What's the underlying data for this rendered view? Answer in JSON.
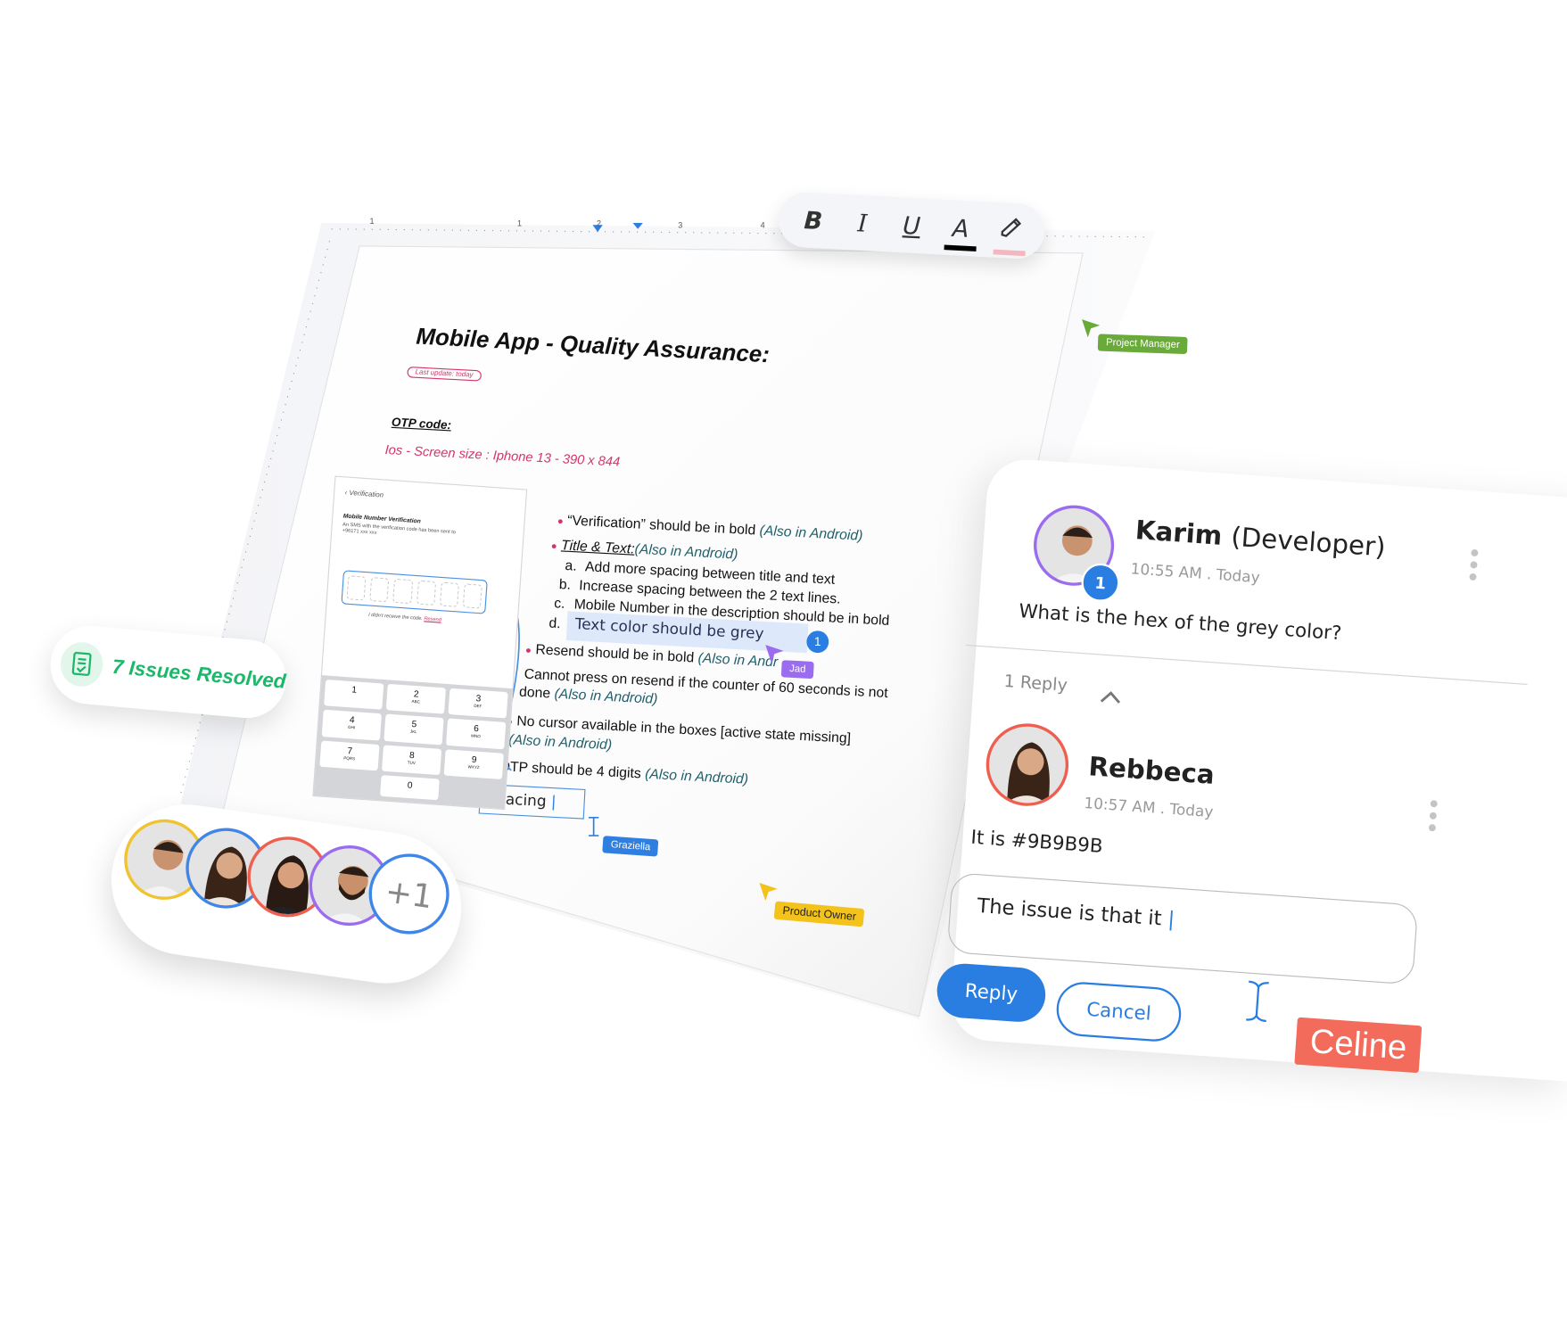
{
  "toolbar": {
    "bold": "B",
    "italic": "I",
    "underline": "U",
    "text_color": "A",
    "icons": [
      "bold-icon",
      "italic-icon",
      "underline-icon",
      "text-color-icon",
      "highlighter-icon"
    ],
    "text_color_value": "#000000",
    "highlight_color_value": "#f4b6bf"
  },
  "ruler": {
    "labels": [
      "1",
      "1",
      "2",
      "3",
      "4"
    ]
  },
  "document": {
    "title": "Mobile App - Quality Assurance:",
    "last_update": "Last update: today",
    "section": "OTP code:",
    "screen_size": "Ios - Screen size : Iphone 13 - 390 x 844",
    "phone": {
      "header": "Verification",
      "heading": "Mobile Number Verification",
      "body": "An SMS with the verification code has been sent to +96171 xxx xxx",
      "resend": "I didn't receive the code.",
      "resend_link": "Resend",
      "keys": [
        [
          "1",
          ""
        ],
        [
          "2",
          "ABC"
        ],
        [
          "3",
          "DEF"
        ],
        [
          "4",
          "GHI"
        ],
        [
          "5",
          "JKL"
        ],
        [
          "6",
          "MNO"
        ],
        [
          "7",
          "PQRS"
        ],
        [
          "8",
          "TUV"
        ],
        [
          "9",
          "WXYZ"
        ],
        [
          "",
          ""
        ],
        [
          "0",
          ""
        ],
        [
          "",
          ""
        ]
      ]
    },
    "items": {
      "verification": "“Verification” should be in bold",
      "also": "(Also in Android)",
      "title_text": "Title & Text:",
      "sub": [
        {
          "marker": "a.",
          "text": "Add more spacing between title and text"
        },
        {
          "marker": "b.",
          "text": "Increase spacing between the 2 text lines."
        },
        {
          "marker": "c.",
          "text": "Mobile Number in the description should be in bold"
        },
        {
          "marker": "d.",
          "text": "Text color should be grey"
        }
      ],
      "resend": "Resend should be in bold",
      "also_cut": "(Also in Andr",
      "cannot_1": "Cannot press on resend if the counter of 60 seconds is not",
      "cannot_2": "done",
      "cursor": "No cursor available in the boxes [active state missing]",
      "otp4": "OTP should be 4 digits",
      "spacing_input": "Spacing"
    },
    "comment_badge": "1"
  },
  "collaborators": {
    "jad": {
      "label": "Jad",
      "color": "#9b6cf0"
    },
    "graziella": {
      "label": "Graziella",
      "color": "#2f7fe0"
    },
    "project_manager": {
      "label": "Project Manager",
      "color": "#6aaa3a"
    },
    "product_owner": {
      "label": "Product Owner",
      "color": "#f3c21b"
    },
    "celine": {
      "label": "Celine",
      "color": "#f26b5b"
    }
  },
  "issues_pill": {
    "text": "7 Issues Resolved",
    "color": "#1cb86a"
  },
  "avatars": {
    "ring_colors": [
      "#f0c330",
      "#3f86e8",
      "#ef5f50",
      "#9b6cf0"
    ],
    "more": "+1"
  },
  "comments": {
    "thread": {
      "author": "Karim",
      "role": "(Developer)",
      "time": "10:55 AM . Today",
      "badge": "1",
      "text": "What is the hex of the grey color?",
      "replies": "1 Reply"
    },
    "reply": {
      "author": "Rebbeca",
      "time": "10:57 AM . Today",
      "text": "It is #9B9B9B"
    },
    "input_value": "The issue is that it ",
    "reply_button": "Reply",
    "cancel_button": "Cancel",
    "accent": "#2a7de1"
  }
}
